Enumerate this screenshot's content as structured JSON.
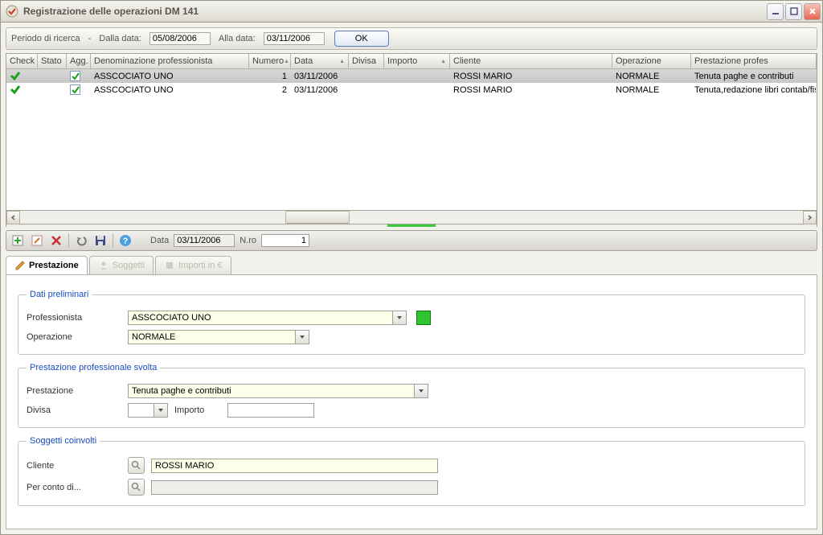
{
  "window": {
    "title": "Registrazione delle operazioni DM 141"
  },
  "search": {
    "label_periodo": "Periodo di ricerca",
    "label_dalla": "Dalla data:",
    "data_da": "05/08/2006",
    "label_alla": "Alla data:",
    "data_a": "03/11/2006",
    "ok": "OK"
  },
  "grid": {
    "headers": {
      "check": "Check",
      "stato": "Stato",
      "agg": "Agg.",
      "den": "Denominazione professionista",
      "numero": "Numero",
      "data": "Data",
      "divisa": "Divisa",
      "importo": "Importo",
      "cliente": "Cliente",
      "operazione": "Operazione",
      "prestazione": "Prestazione profes"
    },
    "rows": [
      {
        "den": "ASSCOCIATO UNO",
        "numero": "1",
        "data": "03/11/2006",
        "divisa": "",
        "importo": "",
        "cliente": "ROSSI MARIO",
        "operazione": "NORMALE",
        "prestazione": "Tenuta paghe e contributi"
      },
      {
        "den": "ASSCOCIATO UNO",
        "numero": "2",
        "data": "03/11/2006",
        "divisa": "",
        "importo": "",
        "cliente": "ROSSI MARIO",
        "operazione": "NORMALE",
        "prestazione": "Tenuta,redazione libri contab/fis"
      }
    ]
  },
  "toolbar": {
    "data_label": "Data",
    "data_value": "03/11/2006",
    "nro_label": "N.ro",
    "nro_value": "1"
  },
  "tabs": {
    "prestazione": "Prestazione",
    "soggetti": "Soggetti",
    "importi": "Importi in €"
  },
  "form": {
    "fs1_legend": "Dati preliminari",
    "label_professionista": "Professionista",
    "val_professionista": "ASSCOCIATO UNO",
    "label_operazione": "Operazione",
    "val_operazione": "NORMALE",
    "fs2_legend": "Prestazione professionale svolta",
    "label_prestazione": "Prestazione",
    "val_prestazione": "Tenuta paghe e contributi",
    "label_divisa": "Divisa",
    "val_divisa": "",
    "label_importo": "Importo",
    "val_importo": "",
    "fs3_legend": "Soggetti coinvolti",
    "label_cliente": "Cliente",
    "val_cliente": "ROSSI MARIO",
    "label_conto": "Per conto di...",
    "val_conto": ""
  }
}
